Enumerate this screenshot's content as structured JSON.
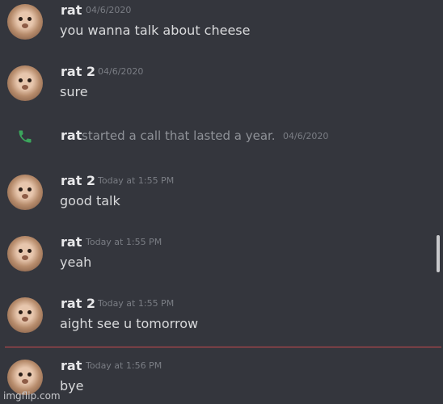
{
  "messages": [
    {
      "author": "rat",
      "timestamp": "04/6/2020",
      "text": "you wanna talk about cheese"
    },
    {
      "author": "rat 2",
      "timestamp": "04/6/2020",
      "text": "sure"
    },
    {
      "author": "rat 2",
      "timestamp": "Today at 1:55 PM",
      "text": "good talk"
    },
    {
      "author": "rat",
      "timestamp": "Today at 1:55 PM",
      "text": "yeah"
    },
    {
      "author": "rat 2",
      "timestamp": "Today at 1:55 PM",
      "text": "aight see u tomorrow"
    },
    {
      "author": "rat",
      "timestamp": "Today at 1:56 PM",
      "text": "bye"
    }
  ],
  "call": {
    "icon": "phone-icon",
    "author": "rat",
    "text": "started a call that lasted a year.",
    "timestamp": "04/6/2020"
  },
  "colors": {
    "background": "#34363d",
    "divider": "#c94a4f",
    "call_icon": "#3ba55c"
  },
  "watermark": "imgflip.com"
}
